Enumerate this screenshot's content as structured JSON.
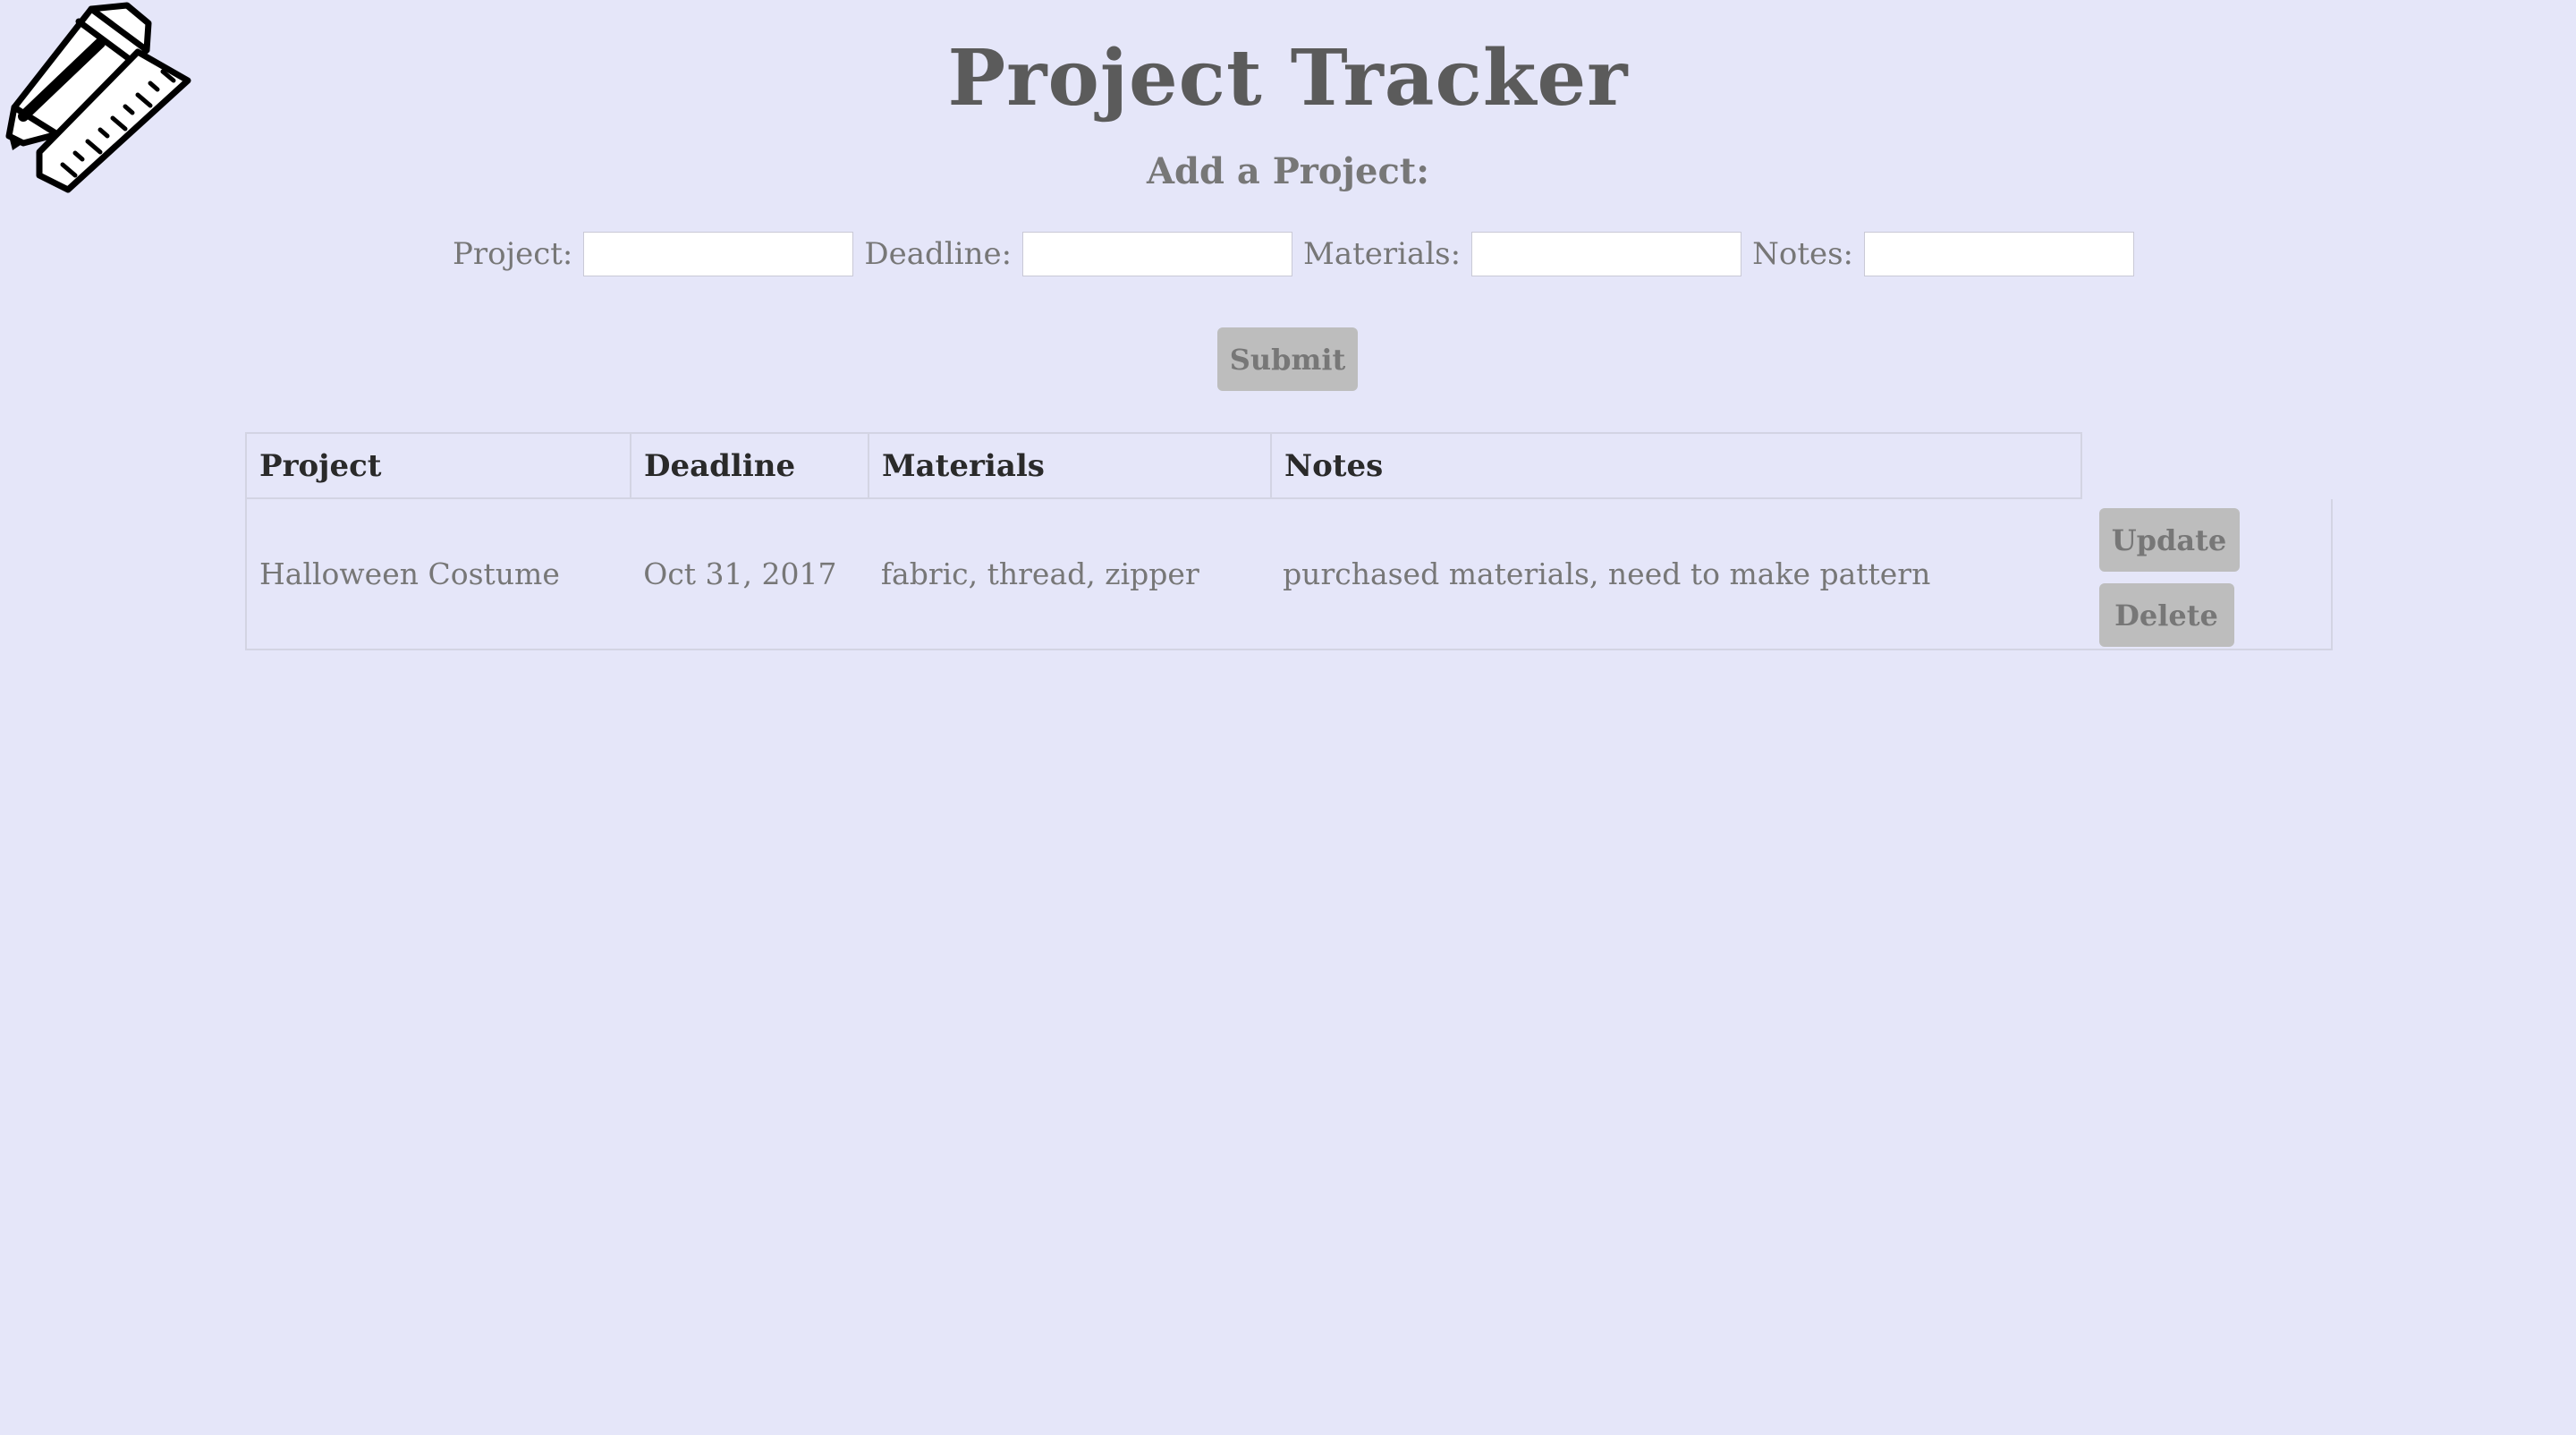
{
  "header": {
    "title": "Project Tracker",
    "subtitle": "Add a Project:",
    "logo_icon": "pencil-and-ruler-icon"
  },
  "form": {
    "fields": [
      {
        "label": "Project:",
        "value": "",
        "placeholder": ""
      },
      {
        "label": "Deadline:",
        "value": "",
        "placeholder": ""
      },
      {
        "label": "Materials:",
        "value": "",
        "placeholder": ""
      },
      {
        "label": "Notes:",
        "value": "",
        "placeholder": ""
      }
    ],
    "submit_label": "Submit"
  },
  "table": {
    "columns": [
      "Project",
      "Deadline",
      "Materials",
      "Notes"
    ],
    "rows": [
      {
        "project": "Halloween Costume",
        "deadline": "Oct 31, 2017",
        "materials": "fabric, thread, zipper",
        "notes": "purchased materials, need to make pattern",
        "update_label": "Update",
        "delete_label": "Delete"
      }
    ]
  },
  "colors": {
    "background": "#e5e6f9",
    "button": "#bdbdbd",
    "border": "#d3d4e3"
  }
}
